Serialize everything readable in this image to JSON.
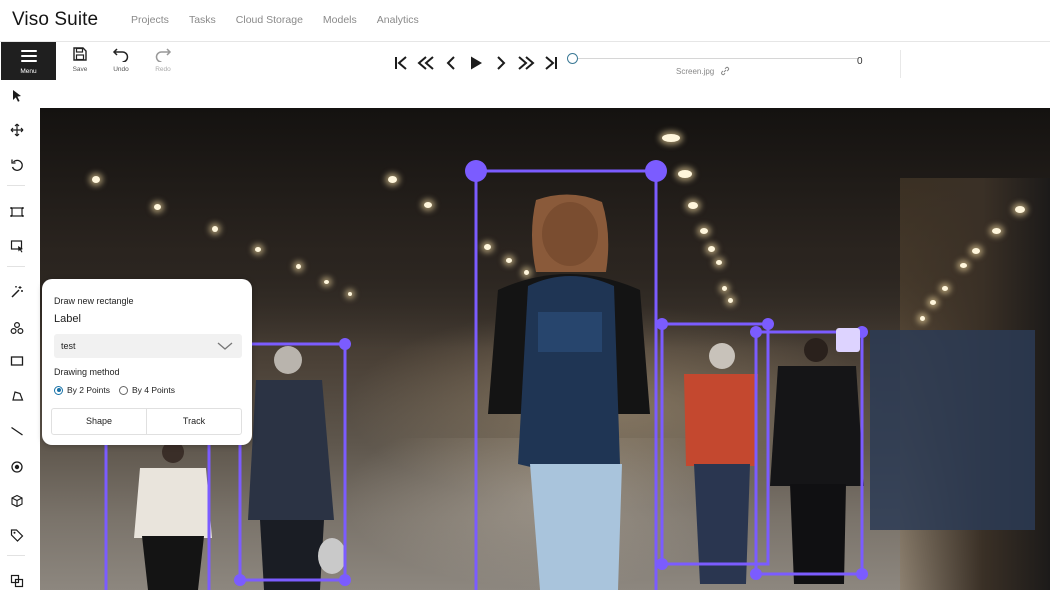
{
  "app": {
    "brand": "Viso Suite"
  },
  "nav": [
    "Projects",
    "Tasks",
    "Cloud Storage",
    "Models",
    "Analytics"
  ],
  "toolbar": {
    "menu_label": "Menu",
    "save_label": "Save",
    "undo_label": "Undo",
    "redo_label": "Redo",
    "player_icons": [
      "first-frame-icon",
      "back-ten-icon",
      "previous-frame-icon",
      "play-icon",
      "next-frame-icon",
      "forward-ten-icon",
      "last-frame-icon"
    ],
    "frame_position": 0,
    "filename": "Screen.jpg",
    "frame_number": "0"
  },
  "sidebar": {
    "tools": [
      "cursor-icon",
      "move-icon",
      "rotate-icon",
      "fit-image-icon",
      "select-region-icon",
      "magic-wand-icon",
      "openvino-icon",
      "rectangle-icon",
      "polygon-icon",
      "polyline-icon",
      "points-icon",
      "cuboid-icon",
      "tag-icon",
      "group-icon"
    ]
  },
  "popup": {
    "title": "Draw new rectangle",
    "label_heading": "Label",
    "label_value": "test",
    "method_heading": "Drawing method",
    "option_two": "By 2 Points",
    "option_four": "By 4 Points",
    "selected_option": "By 2 Points",
    "shape_button": "Shape",
    "track_button": "Track"
  },
  "colors": {
    "annotation": "#7b5cff",
    "toolbar_dark": "#1f1f1f",
    "radio_accent": "#1a73a8"
  }
}
